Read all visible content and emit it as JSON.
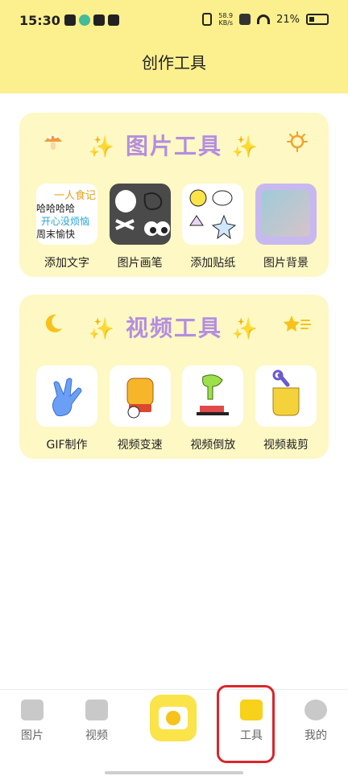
{
  "status": {
    "time": "15:30",
    "speed_top": "58.9",
    "speed_bottom": "KB/s",
    "battery": "21%"
  },
  "header": {
    "title": "创作工具"
  },
  "image_tools": {
    "title": "图片工具",
    "sparkle": "✨",
    "items": [
      {
        "label": "添加文字",
        "icon": "text-icon"
      },
      {
        "label": "图片画笔",
        "icon": "brush-icon"
      },
      {
        "label": "添加贴纸",
        "icon": "sticker-icon"
      },
      {
        "label": "图片背景",
        "icon": "background-icon"
      }
    ],
    "thumb_text": [
      "一人食记",
      "哈哈哈哈",
      "开心没烦恼",
      "周末愉快"
    ]
  },
  "video_tools": {
    "title": "视频工具",
    "sparkle": "✨",
    "items": [
      {
        "label": "GIF制作",
        "icon": "gif-icon"
      },
      {
        "label": "视频变速",
        "icon": "speed-icon"
      },
      {
        "label": "视频倒放",
        "icon": "reverse-icon"
      },
      {
        "label": "视频裁剪",
        "icon": "crop-icon"
      }
    ]
  },
  "nav": {
    "items": [
      {
        "label": "图片"
      },
      {
        "label": "视频"
      },
      {
        "label": "工具"
      },
      {
        "label": "我的"
      }
    ]
  }
}
